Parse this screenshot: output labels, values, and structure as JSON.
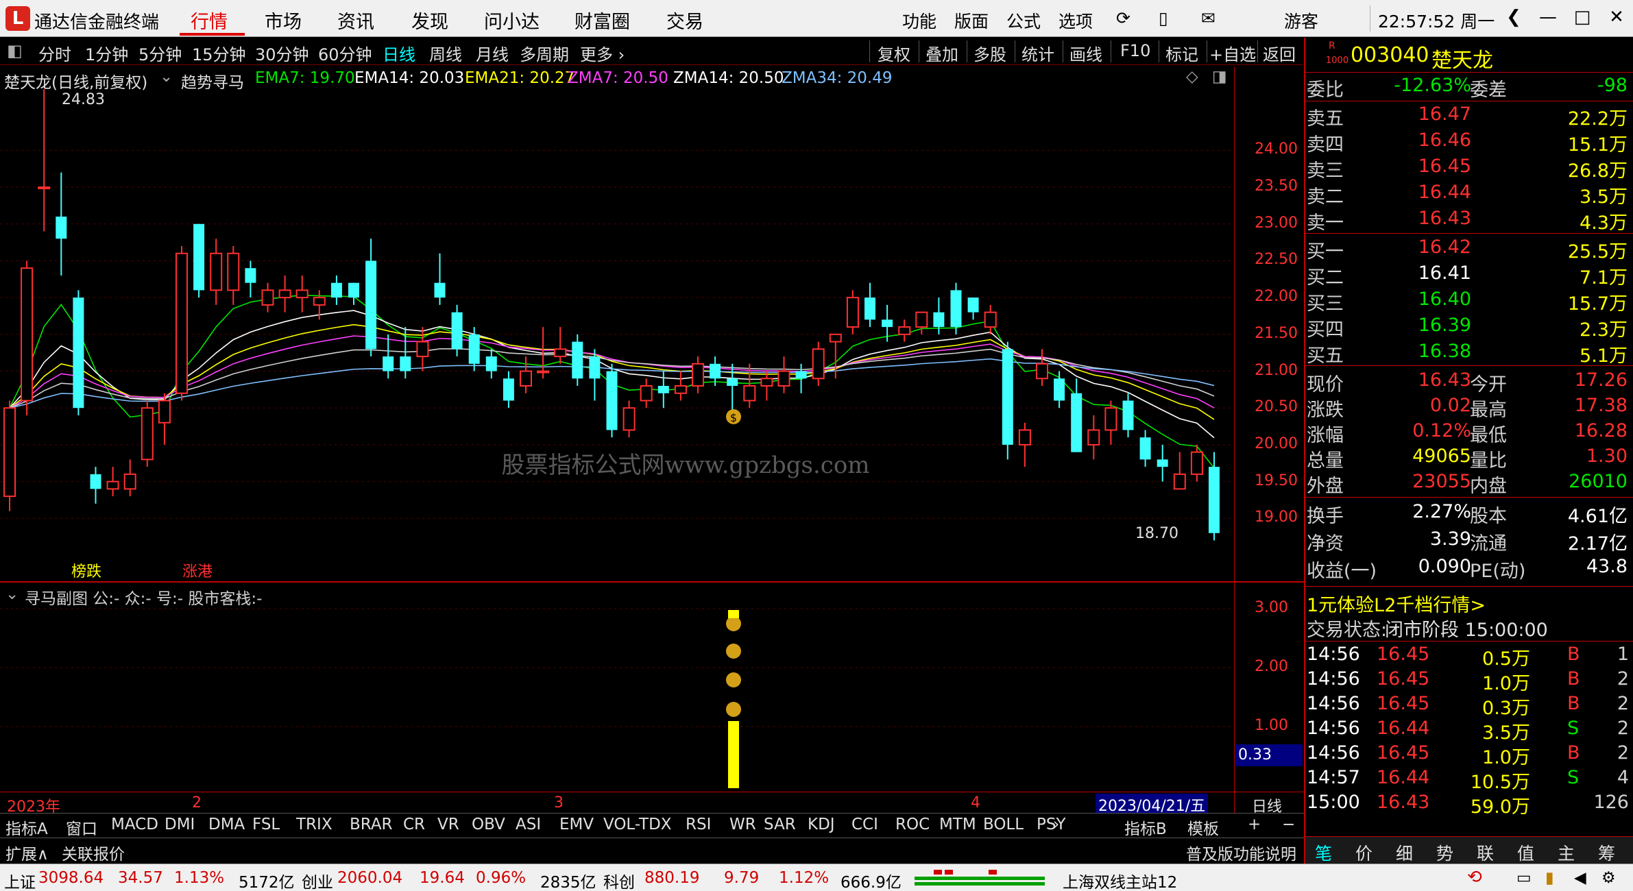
{
  "app": {
    "name": "通达信金融终端",
    "nav": [
      "行情",
      "市场",
      "资讯",
      "发现",
      "问小达",
      "财富圈",
      "交易"
    ],
    "active_nav": "行情",
    "right_menu": [
      "功能",
      "版面",
      "公式",
      "选项"
    ],
    "user": "游客",
    "clock": "22:57:52 周一"
  },
  "toolbar": {
    "periods": [
      "分时",
      "1分钟",
      "5分钟",
      "15分钟",
      "30分钟",
      "60分钟",
      "日线",
      "周线",
      "月线",
      "多周期",
      "更多"
    ],
    "active_period": "日线",
    "right_buttons": [
      "复权",
      "叠加",
      "多股",
      "统计",
      "画线",
      "F10",
      "标记",
      "+自选",
      "返回"
    ]
  },
  "chart": {
    "title": "楚天龙(日线,前复权)",
    "indicator": "趋势寻马",
    "ma_labels": [
      {
        "text": "EMA7: 19.70",
        "color": "#00e600"
      },
      {
        "text": "EMA14: 20.03",
        "color": "#ffffff"
      },
      {
        "text": "EMA21: 20.27",
        "color": "#ffff00"
      },
      {
        "text": "ZMA7: 20.50",
        "color": "#ff40ff"
      },
      {
        "text": "ZMA14: 20.50",
        "color": "#ffffff"
      },
      {
        "text": "ZMA34: 20.49",
        "color": "#80c0ff"
      }
    ],
    "price_axis": [
      "24.00",
      "23.50",
      "23.00",
      "22.50",
      "22.00",
      "21.50",
      "21.00",
      "20.50",
      "20.00",
      "19.50",
      "19.00"
    ],
    "high_label": "24.83",
    "low_label": "18.70",
    "watermark": "股票指标公式网www.gpzbgs.com",
    "tags": [
      "榜跌",
      "涨港"
    ],
    "colors": {
      "up": "#ff3030",
      "down": "#40ffff"
    }
  },
  "chart_data": {
    "type": "candlestick",
    "title": "楚天龙(日线,前复权)",
    "ylim": [
      18.5,
      25.0
    ],
    "candles": [
      [
        19.3,
        20.5,
        20.6,
        19.1
      ],
      [
        20.6,
        22.4,
        22.5,
        20.4
      ],
      [
        23.5,
        23.5,
        24.83,
        22.9
      ],
      [
        23.1,
        22.8,
        23.7,
        22.3
      ],
      [
        22.0,
        20.5,
        22.1,
        20.4
      ],
      [
        19.6,
        19.4,
        19.7,
        19.2
      ],
      [
        19.4,
        19.5,
        19.7,
        19.3
      ],
      [
        19.4,
        19.6,
        19.8,
        19.3
      ],
      [
        19.8,
        20.5,
        20.6,
        19.7
      ],
      [
        20.3,
        20.6,
        20.7,
        20.0
      ],
      [
        20.7,
        22.6,
        22.7,
        20.6
      ],
      [
        23.0,
        22.1,
        23.0,
        22.0
      ],
      [
        22.1,
        22.6,
        22.8,
        21.9
      ],
      [
        22.1,
        22.6,
        22.7,
        21.9
      ],
      [
        22.4,
        22.2,
        22.5,
        22.0
      ],
      [
        21.9,
        22.1,
        22.2,
        21.8
      ],
      [
        22.0,
        22.1,
        22.3,
        21.8
      ],
      [
        22.0,
        22.1,
        22.3,
        21.8
      ],
      [
        21.9,
        22.0,
        22.1,
        21.7
      ],
      [
        22.2,
        22.0,
        22.3,
        21.9
      ],
      [
        22.2,
        22.0,
        22.2,
        21.9
      ],
      [
        22.5,
        21.3,
        22.8,
        21.2
      ],
      [
        21.2,
        21.0,
        21.5,
        20.9
      ],
      [
        21.2,
        21.0,
        21.6,
        20.9
      ],
      [
        21.2,
        21.4,
        21.6,
        21.0
      ],
      [
        22.2,
        22.0,
        22.6,
        21.9
      ],
      [
        21.8,
        21.3,
        21.9,
        21.2
      ],
      [
        21.5,
        21.1,
        21.6,
        21.0
      ],
      [
        21.2,
        21.0,
        21.3,
        20.9
      ],
      [
        20.9,
        20.6,
        21.0,
        20.5
      ],
      [
        20.8,
        21.0,
        21.2,
        20.7
      ],
      [
        21.0,
        21.0,
        21.6,
        20.9
      ],
      [
        21.2,
        21.3,
        21.6,
        21.1
      ],
      [
        21.4,
        20.9,
        21.5,
        20.8
      ],
      [
        21.2,
        20.9,
        21.3,
        20.6
      ],
      [
        21.0,
        20.2,
        21.1,
        20.1
      ],
      [
        20.2,
        20.5,
        20.6,
        20.1
      ],
      [
        20.6,
        20.8,
        20.9,
        20.5
      ],
      [
        20.8,
        20.7,
        21.0,
        20.5
      ],
      [
        20.7,
        20.8,
        21.0,
        20.6
      ],
      [
        20.8,
        21.1,
        21.2,
        20.7
      ],
      [
        21.1,
        20.9,
        21.2,
        20.8
      ],
      [
        20.9,
        20.8,
        21.1,
        20.4
      ],
      [
        20.6,
        20.8,
        21.1,
        20.5
      ],
      [
        20.8,
        20.9,
        21.0,
        20.6
      ],
      [
        20.8,
        21.0,
        21.2,
        20.7
      ],
      [
        21.0,
        20.9,
        21.1,
        20.7
      ],
      [
        20.9,
        21.3,
        21.4,
        20.8
      ],
      [
        21.4,
        21.5,
        21.5,
        20.9
      ],
      [
        21.6,
        22.0,
        22.1,
        21.5
      ],
      [
        22.0,
        21.7,
        22.2,
        21.6
      ],
      [
        21.7,
        21.6,
        21.9,
        21.4
      ],
      [
        21.5,
        21.6,
        21.7,
        21.4
      ],
      [
        21.6,
        21.8,
        21.8,
        21.5
      ],
      [
        21.8,
        21.6,
        22.0,
        21.5
      ],
      [
        22.1,
        21.6,
        22.2,
        21.5
      ],
      [
        22.0,
        21.8,
        22.0,
        21.7
      ],
      [
        21.6,
        21.8,
        21.9,
        21.5
      ],
      [
        21.3,
        20.0,
        21.4,
        19.8
      ],
      [
        20.0,
        20.2,
        20.3,
        19.7
      ],
      [
        20.9,
        21.1,
        21.3,
        20.8
      ],
      [
        20.9,
        20.6,
        21.0,
        20.5
      ],
      [
        20.7,
        19.9,
        20.9,
        19.9
      ],
      [
        20.0,
        20.2,
        20.4,
        19.8
      ],
      [
        20.2,
        20.5,
        20.6,
        20.0
      ],
      [
        20.6,
        20.2,
        20.7,
        20.1
      ],
      [
        20.1,
        19.8,
        20.2,
        19.7
      ],
      [
        19.8,
        19.7,
        20.0,
        19.5
      ],
      [
        19.4,
        19.6,
        19.9,
        19.4
      ],
      [
        19.6,
        19.9,
        20.0,
        19.5
      ],
      [
        19.7,
        18.8,
        19.9,
        18.7
      ]
    ],
    "sub_indicator": {
      "name": "寻马副图",
      "value_label": "0.33",
      "axis": [
        "3.00",
        "2.00",
        "1.00"
      ]
    }
  },
  "subchart": {
    "title": "寻马副图 公:- 众:- 号:- 股市客栈:-",
    "value": "0.33",
    "axis": [
      "3.00",
      "2.00",
      "1.00"
    ]
  },
  "dateaxis": {
    "year": "2023年",
    "m2": "2",
    "m3": "3",
    "m4": "4",
    "cursor": "2023/04/21/五",
    "period": "日线"
  },
  "indicators": [
    "指标A",
    "窗口",
    "MACD",
    "DMI",
    "DMA",
    "FSL",
    "TRIX",
    "BRAR",
    "CR",
    "VR",
    "OBV",
    "ASI",
    "EMV",
    "VOL-TDX",
    "RSI",
    "WR",
    "SAR",
    "KDJ",
    "CCI",
    "ROC",
    "MTM",
    "BOLL",
    "PSY"
  ],
  "ind_right": [
    "指标B",
    "模板"
  ],
  "bottom_left": [
    "扩展∧",
    "关联报价"
  ],
  "bottom_right": "普及版功能说明",
  "status": {
    "sh": {
      "name": "上证",
      "val": "3098.64",
      "chg": "34.57",
      "pct": "1.13%",
      "amt": "5172亿"
    },
    "cy": {
      "name": "创业",
      "val": "2060.04",
      "chg": "19.64",
      "pct": "0.96%",
      "amt": "2835亿"
    },
    "kc": {
      "name": "科创",
      "val": "880.19",
      "chg": "9.79",
      "pct": "1.12%",
      "amt": "666.9亿"
    },
    "server": "上海双线主站12"
  },
  "quote": {
    "code": "003040",
    "name": "楚天龙",
    "weibi_label": "委比",
    "weibi": "-12.63%",
    "weicha_label": "委差",
    "weicha": "-98",
    "sell": [
      {
        "label": "卖五",
        "price": "16.47",
        "vol": "22.2万"
      },
      {
        "label": "卖四",
        "price": "16.46",
        "vol": "15.1万"
      },
      {
        "label": "卖三",
        "price": "16.45",
        "vol": "26.8万"
      },
      {
        "label": "卖二",
        "price": "16.44",
        "vol": "3.5万"
      },
      {
        "label": "卖一",
        "price": "16.43",
        "vol": "4.3万"
      }
    ],
    "buy": [
      {
        "label": "买一",
        "price": "16.42",
        "vol": "25.5万",
        "color": "#ff3030"
      },
      {
        "label": "买二",
        "price": "16.41",
        "vol": "7.1万",
        "color": "#ffffff"
      },
      {
        "label": "买三",
        "price": "16.40",
        "vol": "15.7万",
        "color": "#00e600"
      },
      {
        "label": "买四",
        "price": "16.39",
        "vol": "2.3万",
        "color": "#00e600"
      },
      {
        "label": "买五",
        "price": "16.38",
        "vol": "5.1万",
        "color": "#00e600"
      }
    ],
    "stats": [
      {
        "l": "现价",
        "v": "16.43",
        "vc": "#ff3030",
        "l2": "今开",
        "v2": "17.26",
        "v2c": "#ff3030"
      },
      {
        "l": "涨跌",
        "v": "0.02",
        "vc": "#ff3030",
        "l2": "最高",
        "v2": "17.38",
        "v2c": "#ff3030"
      },
      {
        "l": "涨幅",
        "v": "0.12%",
        "vc": "#ff3030",
        "l2": "最低",
        "v2": "16.28",
        "v2c": "#ff3030"
      },
      {
        "l": "总量",
        "v": "49065",
        "vc": "#ffff00",
        "l2": "量比",
        "v2": "1.30",
        "v2c": "#ff3030"
      },
      {
        "l": "外盘",
        "v": "23055",
        "vc": "#ff3030",
        "l2": "内盘",
        "v2": "26010",
        "v2c": "#00e600"
      }
    ],
    "stats2": [
      {
        "l": "换手",
        "v": "2.27%",
        "l2": "股本",
        "v2": "4.61亿"
      },
      {
        "l": "净资",
        "v": "3.39",
        "l2": "流通",
        "v2": "2.17亿"
      },
      {
        "l": "收益(一)",
        "v": "0.090",
        "l2": "PE(动)",
        "v2": "43.8"
      }
    ],
    "promo": "1元体验L2千档行情>",
    "trade_status_label": "交易状态:",
    "trade_status": "闭市阶段 15:00:00",
    "ticks": [
      {
        "t": "14:56",
        "p": "16.45",
        "v": "0.5万",
        "s": "B",
        "n": "1"
      },
      {
        "t": "14:56",
        "p": "16.45",
        "v": "1.0万",
        "s": "B",
        "n": "2"
      },
      {
        "t": "14:56",
        "p": "16.45",
        "v": "0.3万",
        "s": "B",
        "n": "2"
      },
      {
        "t": "14:56",
        "p": "16.44",
        "v": "3.5万",
        "s": "S",
        "n": "2"
      },
      {
        "t": "14:56",
        "p": "16.45",
        "v": "1.0万",
        "s": "B",
        "n": "2"
      },
      {
        "t": "14:57",
        "p": "16.44",
        "v": "10.5万",
        "s": "S",
        "n": "4"
      },
      {
        "t": "15:00",
        "p": "16.43",
        "v": "59.0万",
        "s": "",
        "n": "126"
      }
    ],
    "tabs": [
      "笔",
      "价",
      "细",
      "势",
      "联",
      "值",
      "主",
      "筹"
    ]
  }
}
